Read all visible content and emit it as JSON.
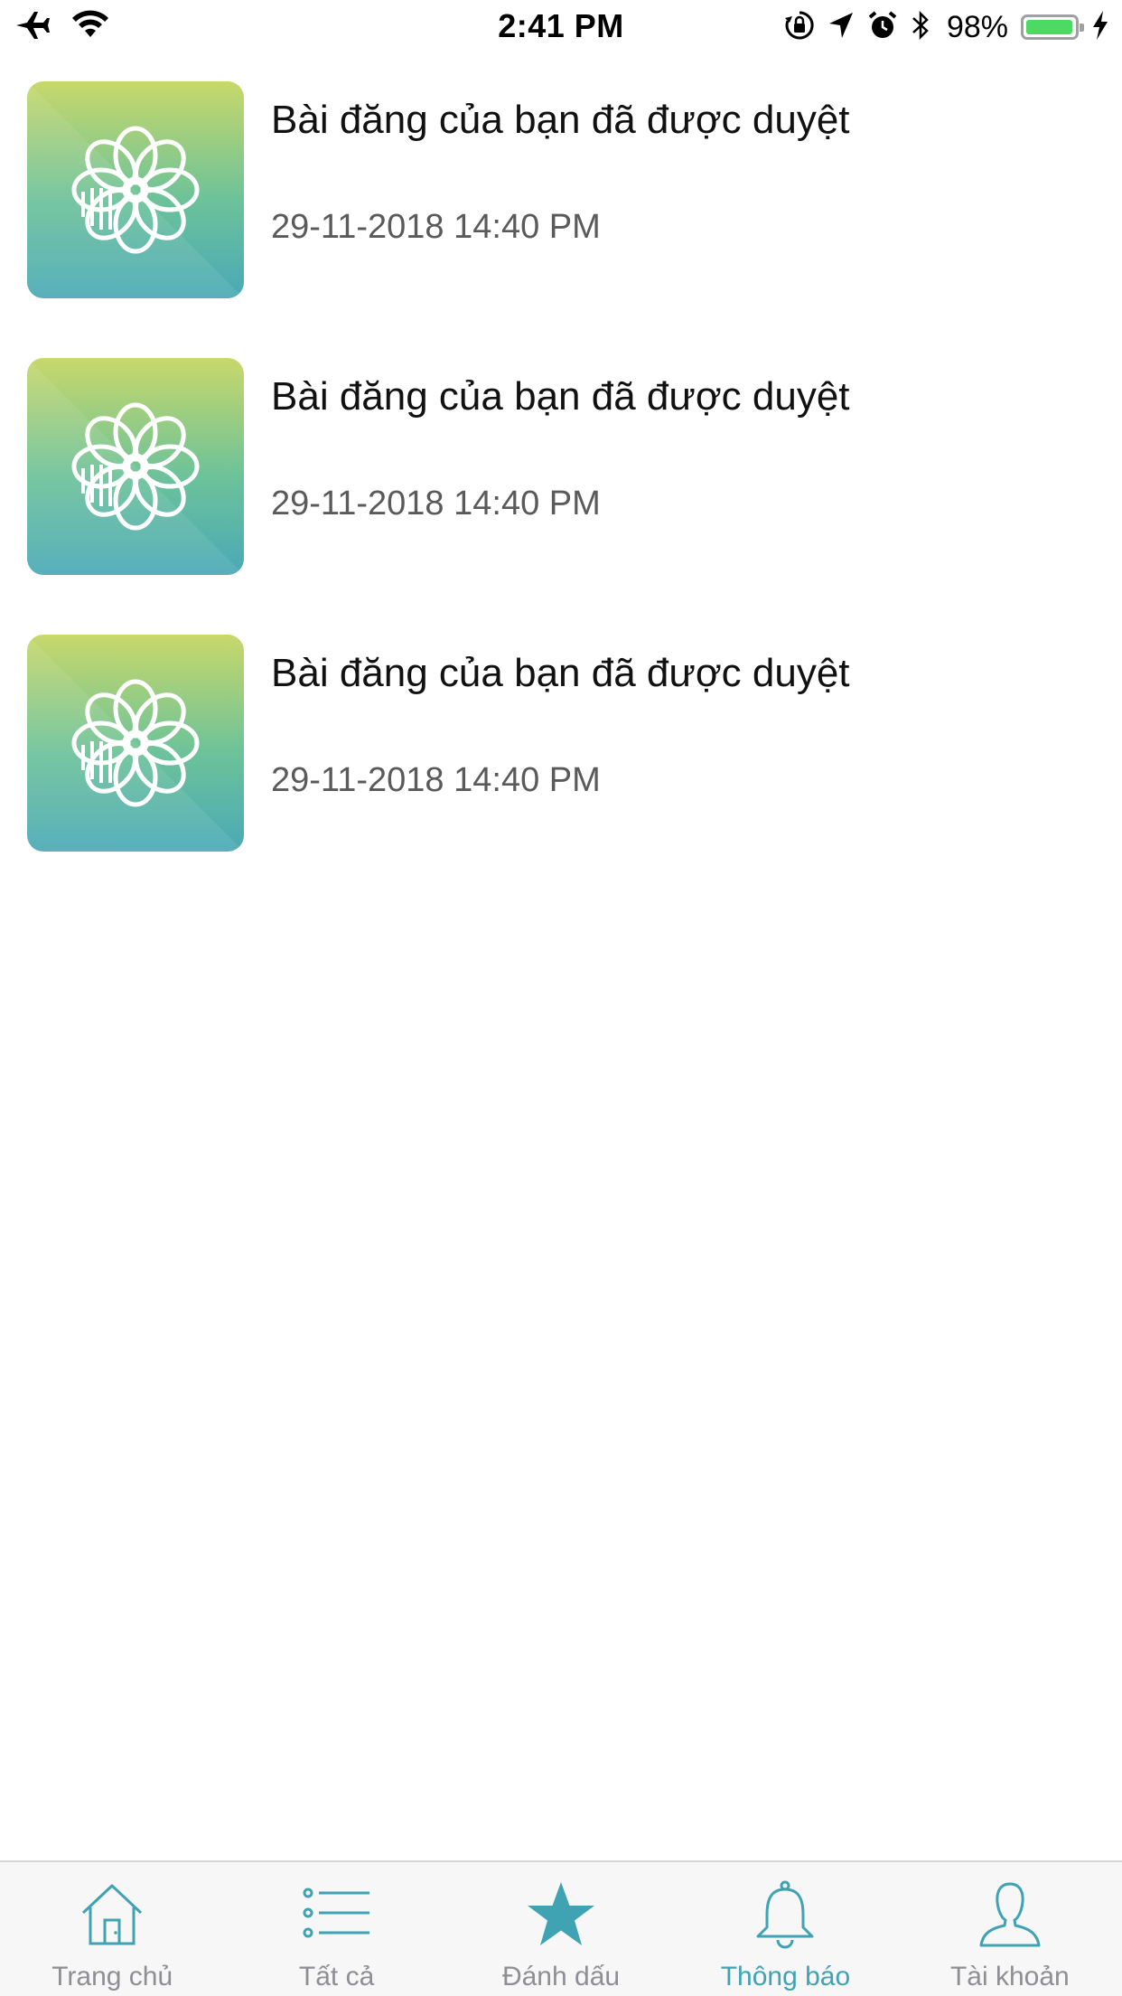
{
  "status_bar": {
    "time": "2:41 PM",
    "battery_percent": "98%",
    "battery_level": 0.98,
    "icons": [
      "airplane-icon",
      "wifi-icon",
      "orientation-lock-icon",
      "location-arrow-icon",
      "alarm-icon",
      "bluetooth-icon",
      "battery-icon",
      "charging-bolt-icon"
    ]
  },
  "notifications": [
    {
      "title": "Bài đăng của bạn đã được duyệt",
      "time": "29-11-2018 14:40 PM",
      "icon": "flower-icon"
    },
    {
      "title": "Bài đăng của bạn đã được duyệt",
      "time": "29-11-2018 14:40 PM",
      "icon": "flower-icon"
    },
    {
      "title": "Bài đăng của bạn đã được duyệt",
      "time": "29-11-2018 14:40 PM",
      "icon": "flower-icon"
    }
  ],
  "tab_bar": {
    "active": "Thông báo",
    "tabs": [
      {
        "label": "Trang chủ",
        "icon": "home-icon"
      },
      {
        "label": "Tất cả",
        "icon": "list-icon"
      },
      {
        "label": "Đánh dấu",
        "icon": "star-icon"
      },
      {
        "label": "Thông báo",
        "icon": "bell-icon"
      },
      {
        "label": "Tài khoản",
        "icon": "user-icon"
      }
    ]
  },
  "colors": {
    "accent": "#3fa3b3",
    "inactive": "#8e8e93",
    "battery_green": "#4cd964",
    "gradient_top": "#c8d86a",
    "gradient_mid": "#6cc29a",
    "gradient_bottom": "#4aa9b6"
  }
}
